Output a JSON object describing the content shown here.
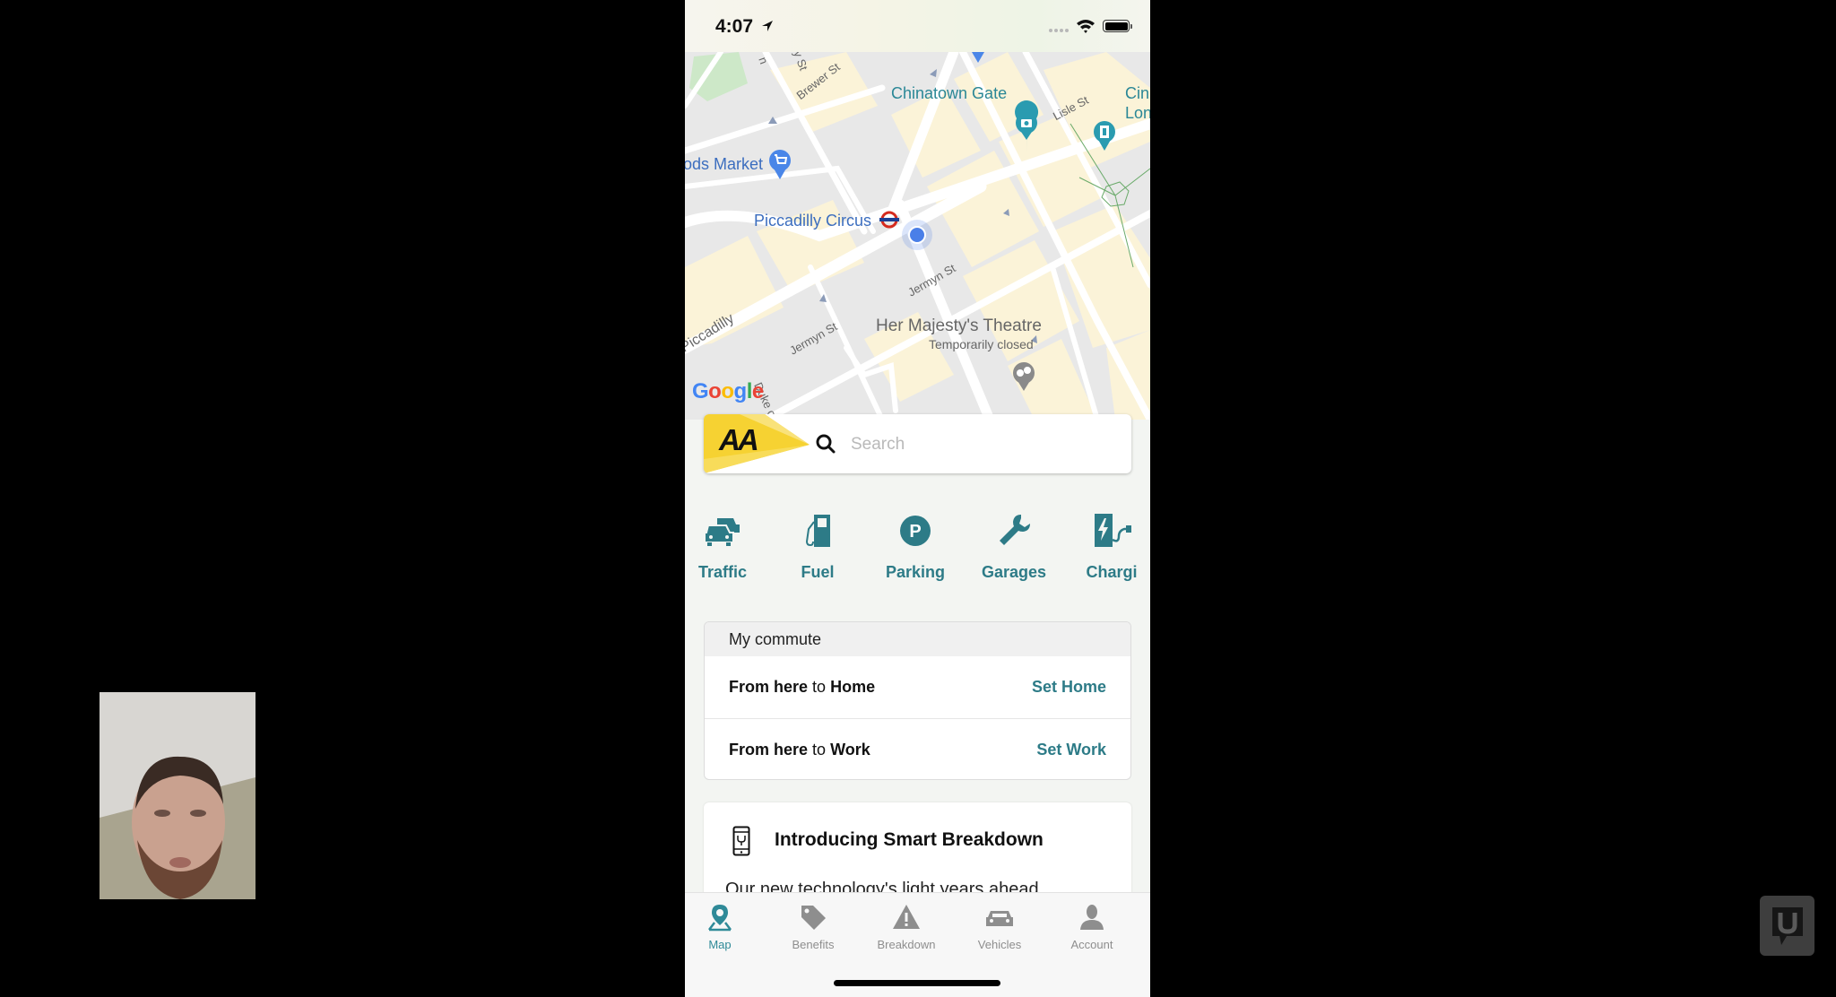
{
  "status_bar": {
    "time": "4:07",
    "location_icon": "location-arrow-icon",
    "wifi_icon": "wifi-icon",
    "battery_icon": "battery-icon"
  },
  "map": {
    "labels": {
      "chinatown_gate": "Chinatown Gate",
      "foods_market": "ods Market",
      "piccadilly_circus": "Piccadilly Circus",
      "cinema_line1": "Cin",
      "cinema_line2": "Lon",
      "theatre": "Her Majesty's Theatre",
      "theatre_status": "Temporarily closed"
    },
    "streets": {
      "brewer": "Brewer St",
      "lisle": "Lisle St",
      "jermyn_1": "Jermyn St",
      "jermyn_2": "Jermyn St",
      "piccadilly": "Piccadilly",
      "duke": "Duke of",
      "top_a": "y St",
      "top_b": "n"
    },
    "attribution": {
      "letters": [
        "G",
        "o",
        "o",
        "g",
        "l",
        "e"
      ],
      "colors": [
        "#4285f4",
        "#ea4335",
        "#fbbc05",
        "#4285f4",
        "#34a853",
        "#ea4335"
      ]
    },
    "user_location_color": "#4a7fe8"
  },
  "search": {
    "brand": "AA",
    "placeholder": "Search",
    "value": ""
  },
  "categories": [
    {
      "label": "Traffic",
      "icon": "traffic-cars-icon"
    },
    {
      "label": "Fuel",
      "icon": "fuel-pump-icon"
    },
    {
      "label": "Parking",
      "icon": "parking-icon"
    },
    {
      "label": "Garages",
      "icon": "wrench-icon"
    },
    {
      "label": "Chargi",
      "icon": "ev-charging-icon"
    }
  ],
  "commute": {
    "header": "My commute",
    "rows": [
      {
        "from": "From here",
        "to_word": "to",
        "dest": "Home",
        "action": "Set Home"
      },
      {
        "from": "From here",
        "to_word": "to",
        "dest": "Work",
        "action": "Set Work"
      }
    ]
  },
  "smart_breakdown": {
    "title": "Introducing Smart Breakdown",
    "body": "Our new technology's light years ahead",
    "icon": "smartphone-wrench-icon"
  },
  "tabbar": {
    "tabs": [
      {
        "label": "Map",
        "icon": "map-pin-icon",
        "active": true
      },
      {
        "label": "Benefits",
        "icon": "tag-icon",
        "active": false
      },
      {
        "label": "Breakdown",
        "icon": "warning-triangle-icon",
        "active": false
      },
      {
        "label": "Vehicles",
        "icon": "car-icon",
        "active": false
      },
      {
        "label": "Account",
        "icon": "person-icon",
        "active": false
      }
    ]
  },
  "colors": {
    "accent_teal": "#2d7b87",
    "aa_yellow": "#f6d232",
    "tab_inactive": "#8e8e8e"
  }
}
